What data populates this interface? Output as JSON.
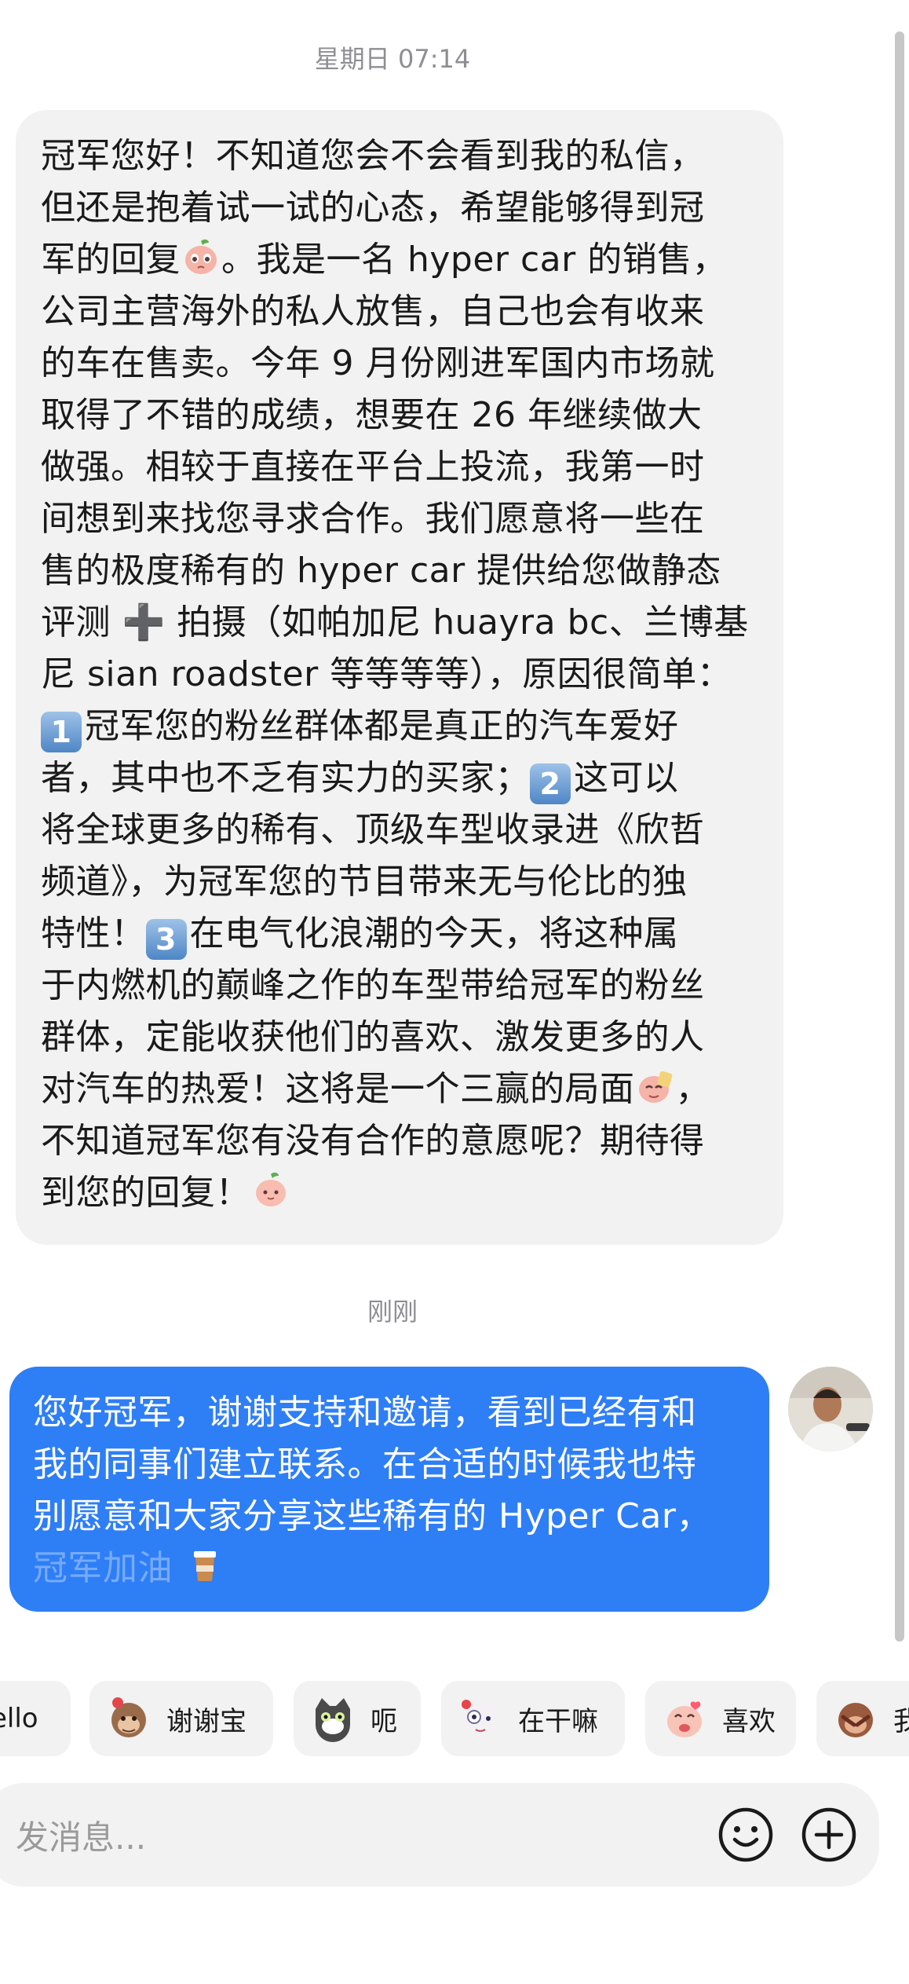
{
  "timestamps": {
    "first": "星期日 07:14",
    "second": "刚刚"
  },
  "incoming_message": {
    "lines": [
      "冠军您好！不知道您会不会看到我的私信，",
      "但还是抱着试一试的心态，希望能够得到冠",
      "军的回复",
      "。我是一名 hyper car 的销售，",
      "公司主营海外的私人放售，自己也会有收来",
      "的车在售卖。今年 9 月份刚进军国内市场就",
      "取得了不错的成绩，想要在 26 年继续做大",
      "做强。相较于直接在平台上投流，我第一时",
      "间想到来找您寻求合作。我们愿意将一些在",
      "售的极度稀有的 hyper car 提供给您做静态",
      "评测 ",
      "➕",
      " 拍摄（如帕加尼 huayra bc、兰博基",
      "尼 sian roadster 等等等等），原因很简单：",
      "1",
      "冠军您的粉丝群体都是真正的汽车爱好",
      "者，其中也不乏有实力的买家；",
      "2",
      "这可以",
      "将全球更多的稀有、顶级车型收录进《欣哲",
      "频道》，为冠军您的节目带来无与伦比的独",
      "特性！",
      "3",
      "在电气化浪潮的今天，将这种属",
      "于内燃机的巅峰之作的车型带给冠军的粉丝",
      "群体，定能收获他们的喜欢、激发更多的人",
      "对汽车的热爱！这将是一个三赢的局面",
      "，",
      "不知道冠军您有没有合作的意愿呢？期待得",
      "到您的回复！"
    ]
  },
  "outgoing_message": {
    "lines": [
      "您好冠军，谢谢支持和邀请，看到已经有和",
      "我的同事们建立联系。在合适的时候我也特",
      "别愿意和大家分享这些稀有的 Hyper Car，",
      "冠军加油"
    ],
    "emoji": "coffee-cup-icon"
  },
  "sticker_suggestions": [
    {
      "label": "ello",
      "icon": "peach-hello-sticker"
    },
    {
      "label": "谢谢宝",
      "icon": "monkey-thanks-sticker"
    },
    {
      "label": "呃",
      "icon": "cat-shocked-sticker"
    },
    {
      "label": "在干嘛",
      "icon": "cat-waving-sticker"
    },
    {
      "label": "喜欢",
      "icon": "peach-love-sticker"
    },
    {
      "label": "我",
      "icon": "monkey-shy-sticker"
    }
  ],
  "composer": {
    "placeholder": "发消息...",
    "emoji_button": "smiley-icon",
    "plus_button": "plus-circle-icon"
  },
  "colors": {
    "outgoing_bubble": "#2e7ef6",
    "incoming_bubble": "#f2f2f2",
    "background": "#ffffff"
  }
}
